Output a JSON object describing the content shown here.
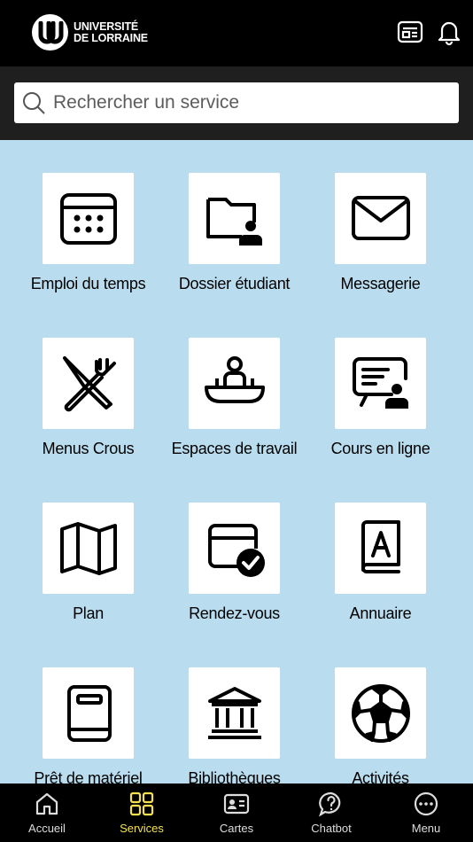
{
  "header": {
    "logo_line1": "UNIVERSITÉ",
    "logo_line2": "DE LORRAINE",
    "icons": [
      "news-card-icon",
      "bell-icon"
    ]
  },
  "search": {
    "placeholder": "Rechercher un service"
  },
  "services": [
    {
      "label": "Emploi du temps",
      "icon": "calendar-icon"
    },
    {
      "label": "Dossier étudiant",
      "icon": "folder-user-icon"
    },
    {
      "label": "Messagerie",
      "icon": "envelope-icon"
    },
    {
      "label": "Menus Crous",
      "icon": "knife-fork-icon"
    },
    {
      "label": "Espaces de travail",
      "icon": "workspace-desk-icon"
    },
    {
      "label": "Cours en ligne",
      "icon": "presentation-user-icon"
    },
    {
      "label": "Plan",
      "icon": "map-icon"
    },
    {
      "label": "Rendez-vous",
      "icon": "calendar-check-icon"
    },
    {
      "label": "Annuaire",
      "icon": "address-book-icon"
    },
    {
      "label": "Prêt de matériel",
      "icon": "book-icon"
    },
    {
      "label": "Bibliothèques",
      "icon": "library-building-icon"
    },
    {
      "label": "Activités",
      "icon": "soccer-ball-icon"
    }
  ],
  "nav": {
    "items": [
      {
        "label": "Accueil",
        "icon": "home-icon"
      },
      {
        "label": "Services",
        "icon": "grid-icon"
      },
      {
        "label": "Cartes",
        "icon": "id-card-icon"
      },
      {
        "label": "Chatbot",
        "icon": "chat-help-icon"
      },
      {
        "label": "Menu",
        "icon": "more-icon"
      }
    ],
    "active": "Services",
    "active_color": "#f5e04e"
  },
  "colors": {
    "background": "#b9ddef",
    "header": "#000000",
    "search_area": "#1f1f1f"
  }
}
